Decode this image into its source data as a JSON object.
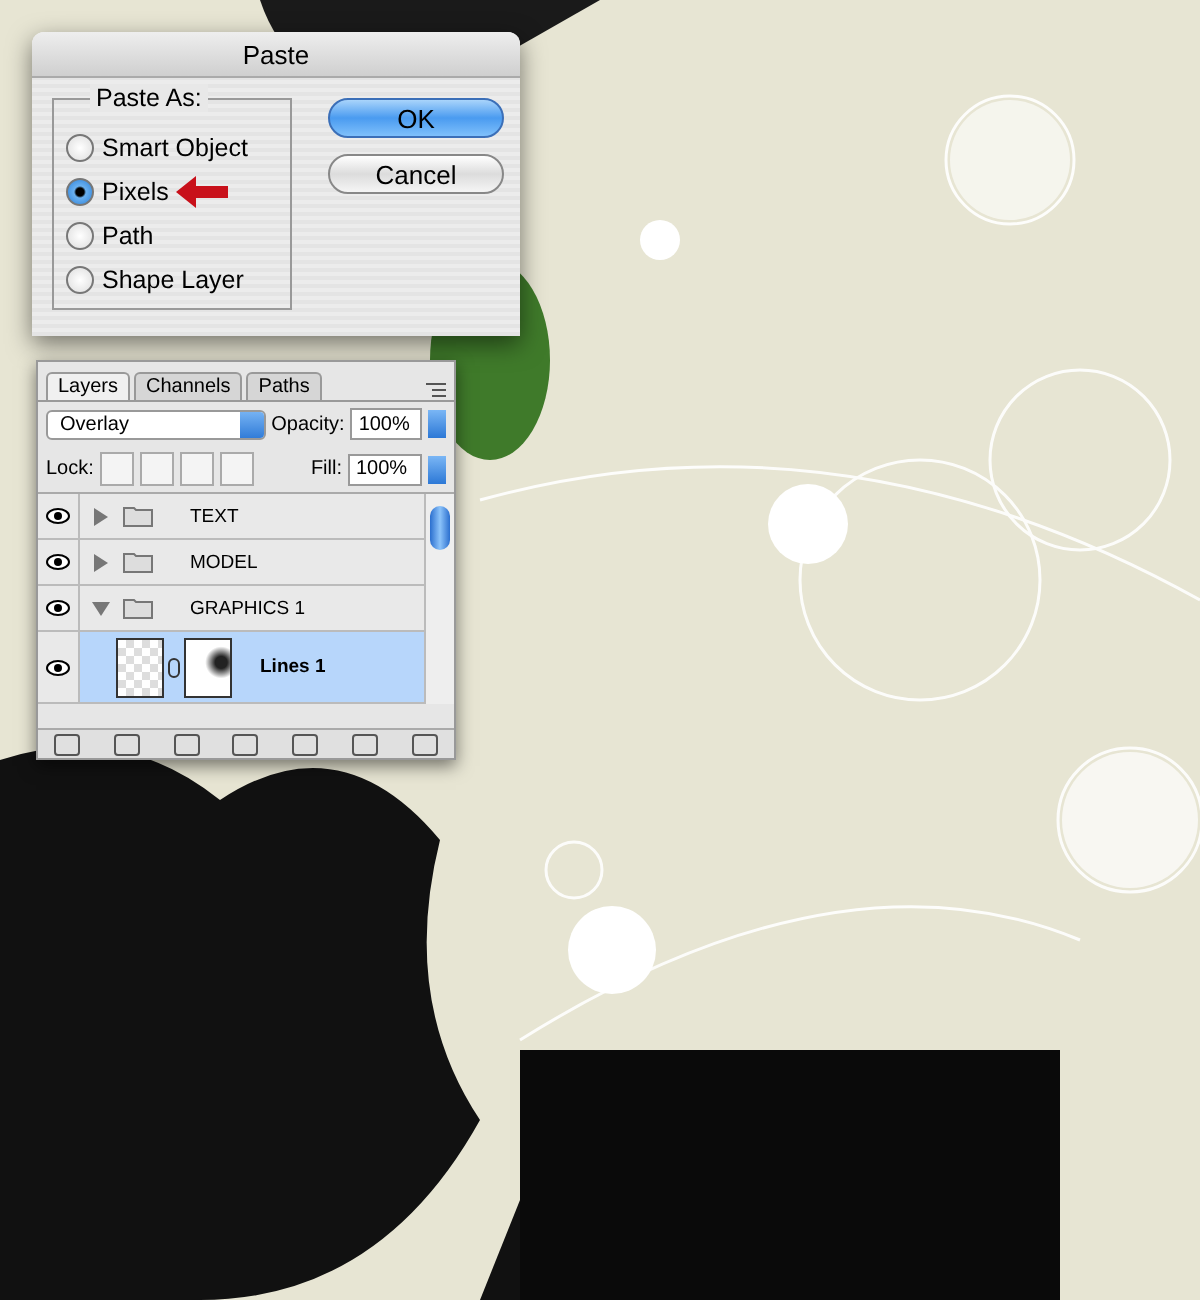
{
  "paste_dialog": {
    "title": "Paste",
    "group_label": "Paste As:",
    "options": [
      {
        "label": "Smart Object",
        "selected": false
      },
      {
        "label": "Pixels",
        "selected": true
      },
      {
        "label": "Path",
        "selected": false
      },
      {
        "label": "Shape Layer",
        "selected": false
      }
    ],
    "buttons": [
      {
        "label": "OK",
        "default": true
      },
      {
        "label": "Cancel",
        "default": false
      }
    ]
  },
  "layers_panel": {
    "tabs": [
      {
        "label": "Layers",
        "selected": true
      },
      {
        "label": "Channels",
        "selected": false
      },
      {
        "label": "Paths",
        "selected": false
      }
    ],
    "blend_mode": "Overlay",
    "opacity_label": "Opacity:",
    "opacity": "100%",
    "lock_label": "Lock:",
    "fill_label": "Fill:",
    "fill": "100%",
    "layers": [
      {
        "kind": "group",
        "name": "TEXT",
        "visible": true,
        "expanded": false,
        "selected": false
      },
      {
        "kind": "group",
        "name": "MODEL",
        "visible": true,
        "expanded": false,
        "selected": false
      },
      {
        "kind": "group",
        "name": "GRAPHICS 1",
        "visible": true,
        "expanded": true,
        "selected": false,
        "children": [
          {
            "kind": "layer",
            "name": "Lines 1",
            "visible": true,
            "selected": true
          }
        ]
      }
    ]
  }
}
